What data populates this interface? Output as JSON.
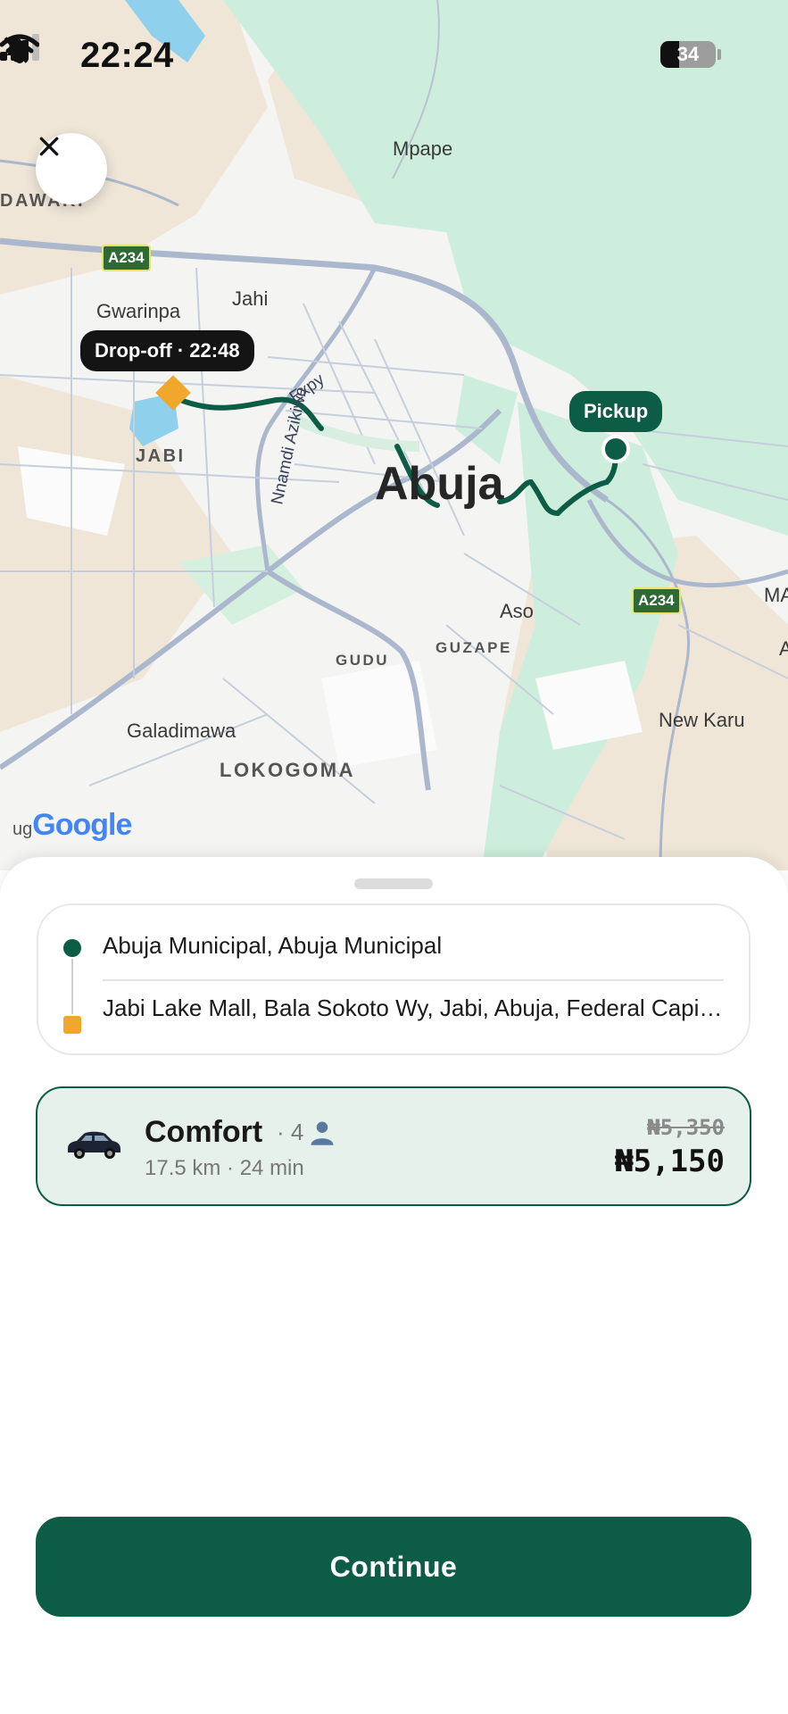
{
  "status_bar": {
    "time": "22:24",
    "battery_level": "34",
    "icons": [
      "bell-muted-icon",
      "signal-icon",
      "wifi-icon",
      "battery-icon"
    ]
  },
  "map": {
    "places": [
      "Mpape",
      "DAWAKI",
      "Gwarinpa",
      "Jahi",
      "JABI",
      "Aso",
      "GUDU",
      "GUZAPE",
      "New Karu",
      "Galadimawa",
      "LOKOGOMA",
      "MA",
      "A"
    ],
    "city": "Abuja",
    "road_name": "Nnamdi Azikiwe Expy",
    "road_badges": [
      "A234",
      "A234"
    ],
    "dropoff_label": "Drop-off · 22:48",
    "pickup_label": "Pickup",
    "attribution": "Google",
    "attribution_prefix": "ug",
    "colors": {
      "route": "#0d5c45",
      "dropoff": "#f0a72b",
      "park": "#cdeedc",
      "land": "#efe6d8"
    }
  },
  "trip": {
    "pickup": "Abuja Municipal, Abuja Municipal",
    "dropoff": "Jabi Lake Mall, Bala Sokoto Wy, Jabi, Abuja, Federal Capital Territory"
  },
  "ride": {
    "name": "Comfort",
    "capacity": "· 4",
    "meta": "17.5 km · 24 min",
    "old_price": "₦5,350",
    "price": "₦5,150"
  },
  "actions": {
    "continue_label": "Continue"
  }
}
